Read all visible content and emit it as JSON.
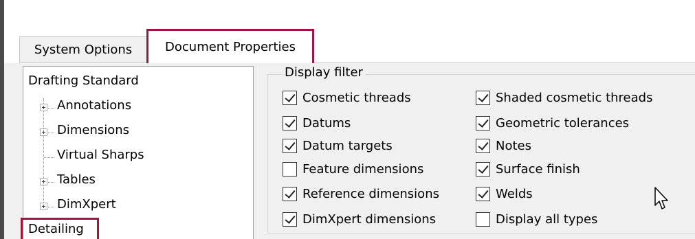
{
  "tabs": [
    {
      "label": "System Options",
      "active": false
    },
    {
      "label": "Document Properties",
      "active": true
    }
  ],
  "tree": {
    "items": [
      {
        "label": "Drafting Standard",
        "expandable": false,
        "selected": false
      },
      {
        "label": "Annotations",
        "expandable": true,
        "selected": false
      },
      {
        "label": "Dimensions",
        "expandable": true,
        "selected": false
      },
      {
        "label": "Virtual Sharps",
        "expandable": false,
        "selected": false
      },
      {
        "label": "Tables",
        "expandable": true,
        "selected": false
      },
      {
        "label": "DimXpert",
        "expandable": true,
        "selected": false
      },
      {
        "label": "Detailing",
        "expandable": false,
        "selected": true
      }
    ]
  },
  "display_filter": {
    "legend": "Display filter",
    "left_column": [
      {
        "label": "Cosmetic threads",
        "checked": true
      },
      {
        "label": "Datums",
        "checked": true
      },
      {
        "label": "Datum targets",
        "checked": true
      },
      {
        "label": "Feature dimensions",
        "checked": false
      },
      {
        "label": "Reference dimensions",
        "checked": true
      },
      {
        "label": "DimXpert dimensions",
        "checked": true
      }
    ],
    "right_column": [
      {
        "label": "Shaded cosmetic threads",
        "checked": true
      },
      {
        "label": "Geometric tolerances",
        "checked": true
      },
      {
        "label": "Notes",
        "checked": true
      },
      {
        "label": "Surface finish",
        "checked": true
      },
      {
        "label": "Welds",
        "checked": true
      },
      {
        "label": "Display all types",
        "checked": false
      }
    ]
  },
  "colors": {
    "highlight": "#a0153e",
    "panel_bg": "#f0f0f0"
  }
}
